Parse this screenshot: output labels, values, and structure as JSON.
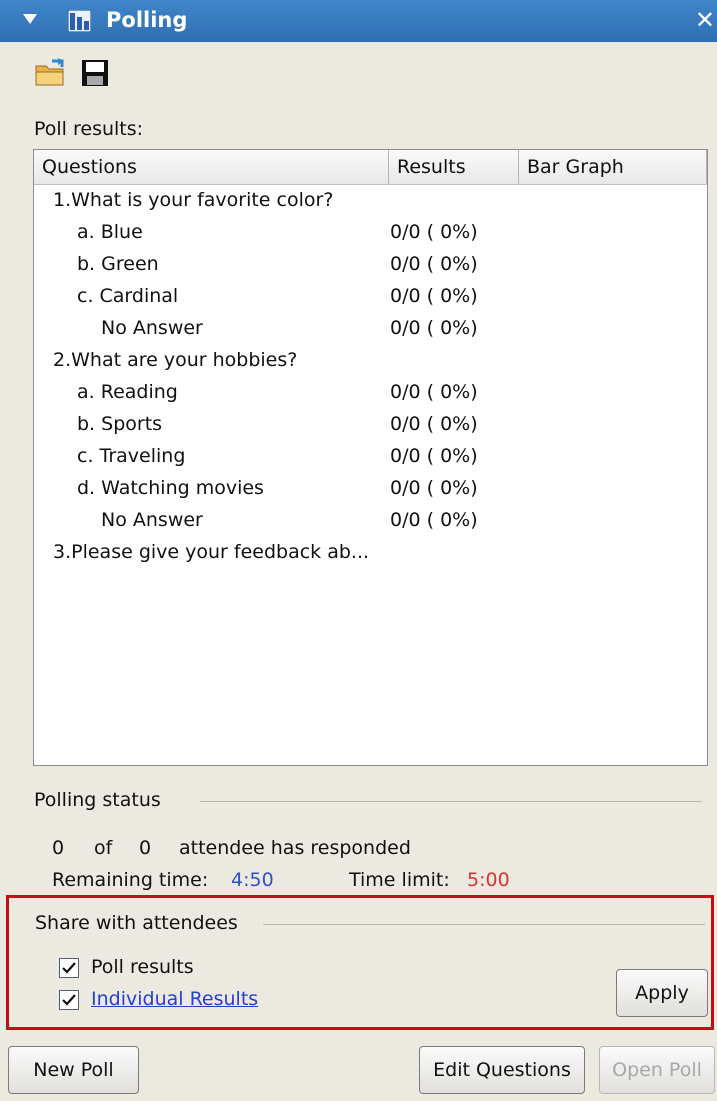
{
  "window": {
    "title": "Polling"
  },
  "toolbar": {
    "icons": [
      "open-folder-icon",
      "save-icon"
    ]
  },
  "results": {
    "label": "Poll results:",
    "columns": {
      "questions": "Questions",
      "results": "Results",
      "bar_graph": "Bar Graph"
    },
    "rows": [
      {
        "text": "1.What is your favorite color?",
        "result": ""
      },
      {
        "text": "a. Blue",
        "result": "0/0 ( 0%)"
      },
      {
        "text": "b. Green",
        "result": "0/0 ( 0%)"
      },
      {
        "text": "c. Cardinal",
        "result": "0/0 ( 0%)"
      },
      {
        "text": "No Answer",
        "result": "0/0 ( 0%)"
      },
      {
        "text": "2.What are your hobbies?",
        "result": ""
      },
      {
        "text": "a. Reading",
        "result": "0/0 ( 0%)"
      },
      {
        "text": "b. Sports",
        "result": "0/0 ( 0%)"
      },
      {
        "text": "c. Traveling",
        "result": "0/0 ( 0%)"
      },
      {
        "text": "d. Watching movies",
        "result": "0/0 ( 0%)"
      },
      {
        "text": "No Answer",
        "result": "0/0 ( 0%)"
      },
      {
        "text": "3.Please give your feedback ab...",
        "result": ""
      }
    ]
  },
  "status": {
    "title": "Polling status",
    "responded_count": "0",
    "of_label": "of",
    "total_count": "0",
    "responded_text": "attendee has responded",
    "remaining_label": "Remaining time:",
    "remaining_value": "4:50",
    "limit_label": "Time limit:",
    "limit_value": "5:00"
  },
  "share": {
    "title": "Share with attendees",
    "poll_results_label": "Poll results",
    "individual_results_label": "Individual Results",
    "apply_label": "Apply"
  },
  "buttons": {
    "new_poll": "New Poll",
    "edit_questions": "Edit Questions",
    "open_poll": "Open Poll"
  },
  "colors": {
    "title_bar": "#3578bd",
    "accent_red": "#c30f14"
  }
}
